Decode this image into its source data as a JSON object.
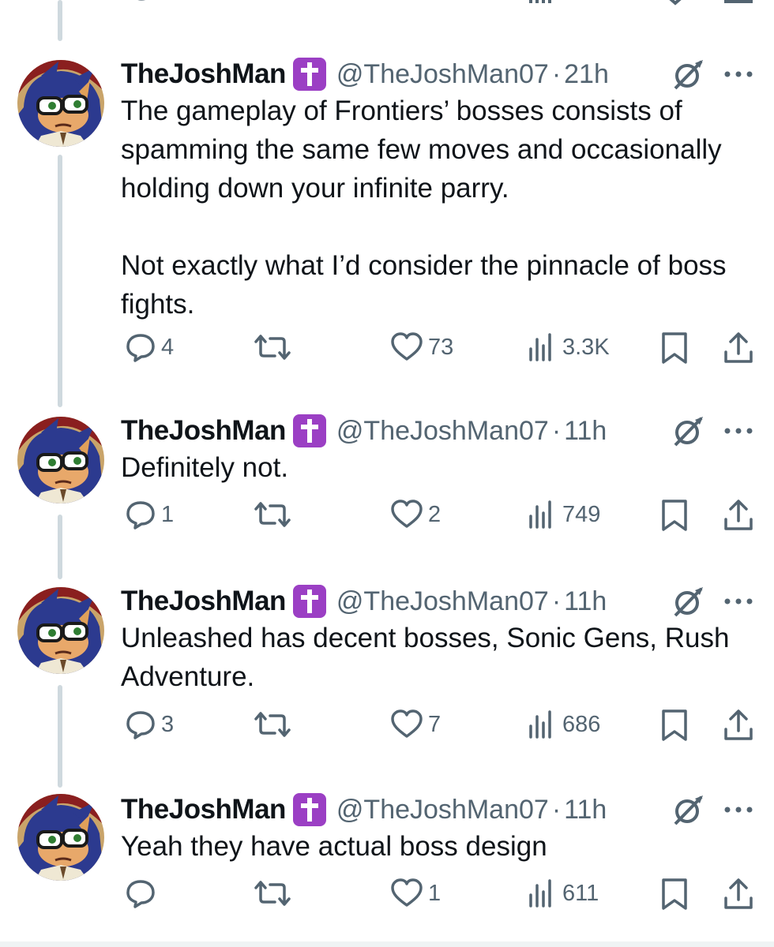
{
  "tweets": [
    {
      "name": "TheJoshMan",
      "handle": "@TheJoshMan07",
      "time": "21h",
      "text": "The gameplay of Frontiers’ bosses consists of spamming the same few moves and occasionally holding down your infinite parry.\n\nNot exactly what I’d consider the pinnacle of boss fights.",
      "replies": "4",
      "reposts": "",
      "likes": "73",
      "views": "3.3K"
    },
    {
      "name": "TheJoshMan",
      "handle": "@TheJoshMan07",
      "time": "11h",
      "text": "Definitely not.",
      "replies": "1",
      "reposts": "",
      "likes": "2",
      "views": "749"
    },
    {
      "name": "TheJoshMan",
      "handle": "@TheJoshMan07",
      "time": "11h",
      "text": "Unleashed has decent bosses, Sonic Gens, Rush Adventure.",
      "replies": "3",
      "reposts": "",
      "likes": "7",
      "views": "686"
    },
    {
      "name": "TheJoshMan",
      "handle": "@TheJoshMan07",
      "time": "11h",
      "text": "Yeah they have actual boss design",
      "replies": "",
      "reposts": "",
      "likes": "1",
      "views": "611"
    }
  ],
  "separator": "·",
  "icons": {
    "badge": "latin-cross-badge-icon",
    "grok": "grok-icon",
    "more": "more-icon",
    "reply": "reply-icon",
    "repost": "repost-icon",
    "like": "like-icon",
    "views": "views-icon",
    "bookmark": "bookmark-icon",
    "share": "share-icon"
  },
  "colors": {
    "text": "#0f1419",
    "secondary": "#536471",
    "badge": "#9b3fc4",
    "thread_line": "#cfd9de"
  }
}
